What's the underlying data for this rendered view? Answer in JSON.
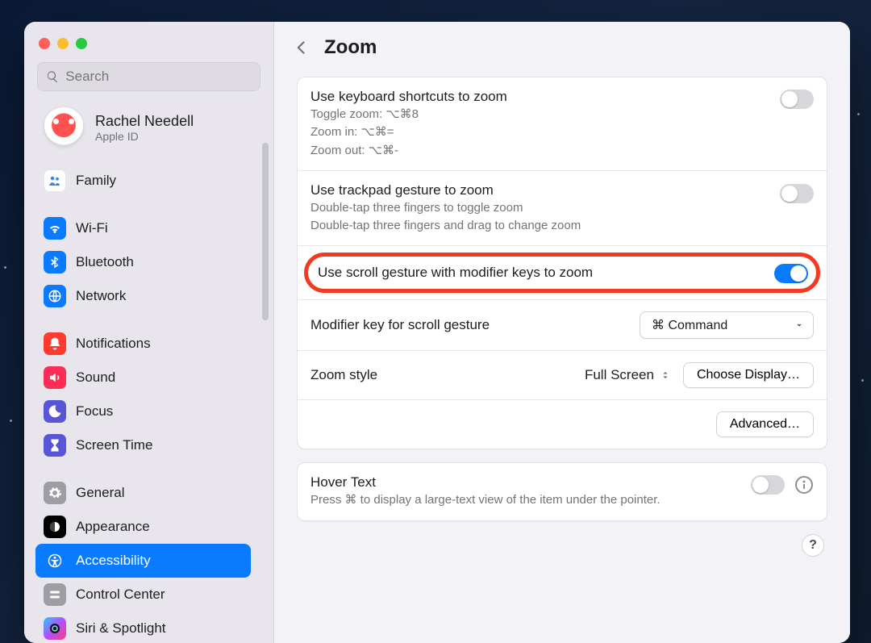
{
  "search": {
    "placeholder": "Search"
  },
  "account": {
    "name": "Rachel Needell",
    "sub": "Apple ID"
  },
  "sidebar": {
    "items": [
      {
        "label": "Family",
        "color": "#ffffff",
        "icon": "family"
      },
      {
        "label": "Wi-Fi",
        "color": "#0a7bff",
        "icon": "wifi"
      },
      {
        "label": "Bluetooth",
        "color": "#0a7bff",
        "icon": "bluetooth"
      },
      {
        "label": "Network",
        "color": "#0a7bff",
        "icon": "network"
      },
      {
        "label": "Notifications",
        "color": "#ff3b30",
        "icon": "bell"
      },
      {
        "label": "Sound",
        "color": "#ff2d55",
        "icon": "sound"
      },
      {
        "label": "Focus",
        "color": "#5856d6",
        "icon": "moon"
      },
      {
        "label": "Screen Time",
        "color": "#5856d6",
        "icon": "hourglass"
      },
      {
        "label": "General",
        "color": "#9d9da4",
        "icon": "gear"
      },
      {
        "label": "Appearance",
        "color": "#000000",
        "icon": "appearance"
      },
      {
        "label": "Accessibility",
        "color": "#0a7bff",
        "icon": "accessibility"
      },
      {
        "label": "Control Center",
        "color": "#9d9da4",
        "icon": "switches"
      },
      {
        "label": "Siri & Spotlight",
        "color": "#1d1d1f",
        "icon": "siri"
      }
    ]
  },
  "page": {
    "title": "Zoom",
    "card1": {
      "r1": {
        "title": "Use keyboard shortcuts to zoom",
        "l1": "Toggle zoom: ⌥⌘8",
        "l2": "Zoom in: ⌥⌘=",
        "l3": "Zoom out: ⌥⌘-"
      },
      "r2": {
        "title": "Use trackpad gesture to zoom",
        "l1": "Double-tap three fingers to toggle zoom",
        "l2": "Double-tap three fingers and drag to change zoom"
      },
      "r3": {
        "title": "Use scroll gesture with modifier keys to zoom"
      },
      "r4": {
        "label": "Modifier key for scroll gesture",
        "value": "⌘ Command"
      },
      "r5": {
        "label": "Zoom style",
        "value": "Full Screen",
        "button": "Choose Display…"
      },
      "r6": {
        "button": "Advanced…"
      }
    },
    "card2": {
      "title": "Hover Text",
      "sub": "Press ⌘ to display a large-text view of the item under the pointer."
    },
    "help": "?"
  }
}
